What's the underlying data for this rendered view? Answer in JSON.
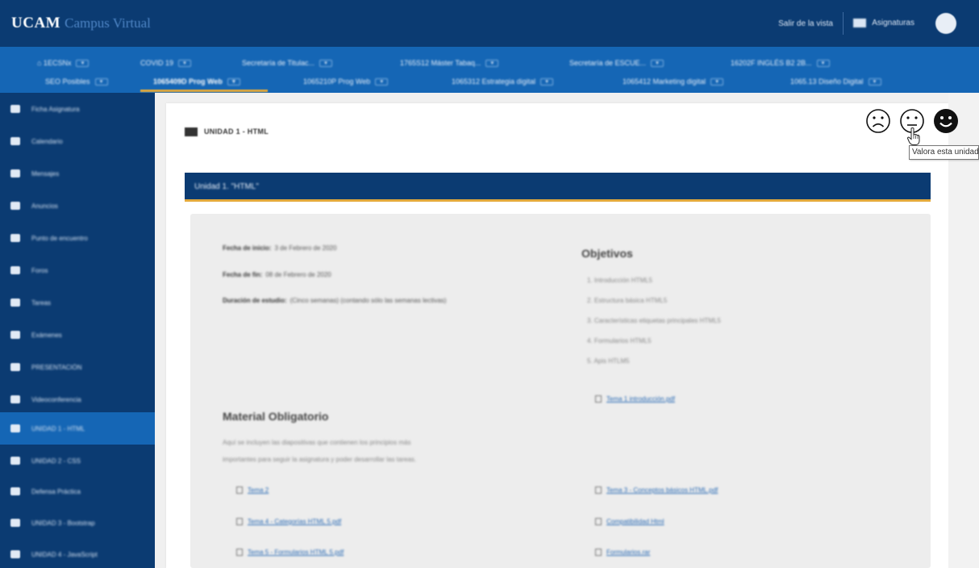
{
  "brand": {
    "name": "UCAM",
    "subtitle": "Campus Virtual"
  },
  "topbar": {
    "exit_label": "Salir de la vista",
    "subjects_label": "Asignaturas"
  },
  "course_tabs_row1": [
    {
      "label": "⌂ 1ECSNx"
    },
    {
      "label": "COVID 19"
    },
    {
      "label": "Secretaría de Titulac..."
    },
    {
      "label": "1765S12 Máster Tabaq..."
    },
    {
      "label": "Secretaría de ESCUE..."
    },
    {
      "label": "16202F INGLÉS B2 2B..."
    }
  ],
  "course_tabs_row2": [
    {
      "label": "SEO Posibles"
    },
    {
      "label": "1065409D Prog Web",
      "active": true
    },
    {
      "label": "1065210P Prog Web"
    },
    {
      "label": "1065312 Estrategia digital"
    },
    {
      "label": "1065412 Marketing digital"
    },
    {
      "label": "1065.13 Diseño Digital"
    }
  ],
  "sidebar": {
    "items": [
      {
        "label": "Ficha Asignatura",
        "icon": "list-icon"
      },
      {
        "label": "Calendario",
        "icon": "calendar-icon"
      },
      {
        "label": "Mensajes",
        "icon": "mail-icon"
      },
      {
        "label": "Anuncios",
        "icon": "megaphone-icon"
      },
      {
        "label": "Punto de encuentro",
        "icon": "people-icon"
      },
      {
        "label": "Foros",
        "icon": "chat-icon"
      },
      {
        "label": "Tareas",
        "icon": "document-icon"
      },
      {
        "label": "Exámenes",
        "icon": "check-icon"
      },
      {
        "label": "PRESENTACIÓN",
        "icon": "folder-icon"
      },
      {
        "label": "Videoconferencia",
        "icon": "video-icon"
      },
      {
        "label": "UNIDAD 1 - HTML",
        "icon": "folder-icon",
        "active": true
      },
      {
        "label": "UNIDAD 2 - CSS",
        "icon": "folder-icon"
      },
      {
        "label": "Defensa Práctica",
        "icon": "folder-icon"
      },
      {
        "label": "UNIDAD 3 - Bootstrap",
        "icon": "folder-icon"
      },
      {
        "label": "UNIDAD 4 - JavaScript",
        "icon": "folder-icon"
      }
    ]
  },
  "unit": {
    "header": "UNIDAD 1 - HTML",
    "banner": "Unidad 1. \"HTML\""
  },
  "rating": {
    "options": [
      "sad",
      "neutral",
      "happy"
    ],
    "tooltip": "Valora esta unidad"
  },
  "info": {
    "start_label": "Fecha de inicio:",
    "start_value": "3 de Febrero de 2020",
    "end_label": "Fecha de fin:",
    "end_value": "08 de Febrero de 2020",
    "duration_label": "Duración de estudio:",
    "duration_value": "(Cinco semanas) (contando sólo las semanas lectivas)"
  },
  "objectives": {
    "title": "Objetivos",
    "items": [
      "1. Introducción HTML5",
      "2. Estructura básica HTML5",
      "3. Características etiquetas principales HTML5",
      "4. Formularios HTML5",
      "5. Apis HTLM5"
    ],
    "file": "Tema 1 introducción.pdf"
  },
  "material": {
    "title": "Material Obligatorio",
    "desc_line1": "Aquí se incluyen las diapositivas que contienen los principios más",
    "desc_line2": "importantes para seguir la asignatura y poder desarrollar las tareas.",
    "files": [
      "Tema 2",
      "Tema 3 - Conceptos básicos HTML.pdf",
      "Tema 4 - Categorías HTML 5.pdf",
      "Compatibilidad Html",
      "Tema 5 - Formularios HTML 5.pdf",
      "Formularios.rar"
    ]
  },
  "colors": {
    "dark_blue": "#0b3b72",
    "mid_blue": "#1566b5",
    "accent_gold": "#e3a93b"
  }
}
